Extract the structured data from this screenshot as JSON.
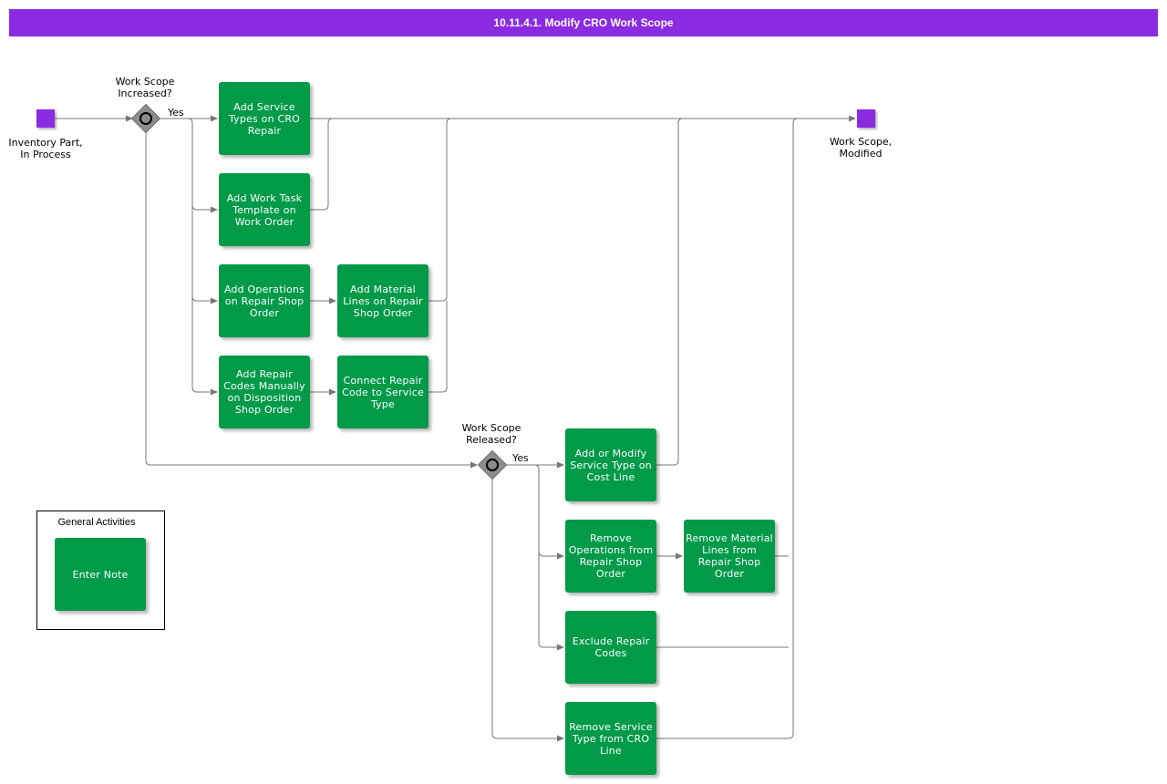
{
  "title": "10.11.4.1. Modify CRO Work Scope",
  "colors": {
    "title_bar": "#8a2be2",
    "task": "#009a49",
    "event": "#8a2be2",
    "connector": "#777777"
  },
  "events": {
    "start": "Inventory Part,\nIn Process",
    "end": "Work Scope,\nModified"
  },
  "gateways": {
    "g1": "Work Scope\nIncreased?",
    "g2": "Work Scope\nReleased?"
  },
  "flow_labels": {
    "g1_yes": "Yes",
    "g2_yes": "Yes"
  },
  "tasks": {
    "t1": "Add Service Types on CRO Repair",
    "t2": "Add Work Task Template on Work Order",
    "t3": "Add Operations on Repair Shop Order",
    "t4": "Add Material Lines on Repair Shop Order",
    "t5": "Add Repair Codes Manually on Disposition Shop Order",
    "t6": "Connect Repair Code to Service Type",
    "t7": "Add or Modify Service Type on Cost Line",
    "t8": "Remove Operations from Repair Shop Order",
    "t9": "Remove Material Lines from Repair Shop Order",
    "t10": "Exclude Repair Codes",
    "t11": "Remove Service Type from CRO Line"
  },
  "general": {
    "label": "General Activities",
    "enter_note": "Enter Note"
  }
}
